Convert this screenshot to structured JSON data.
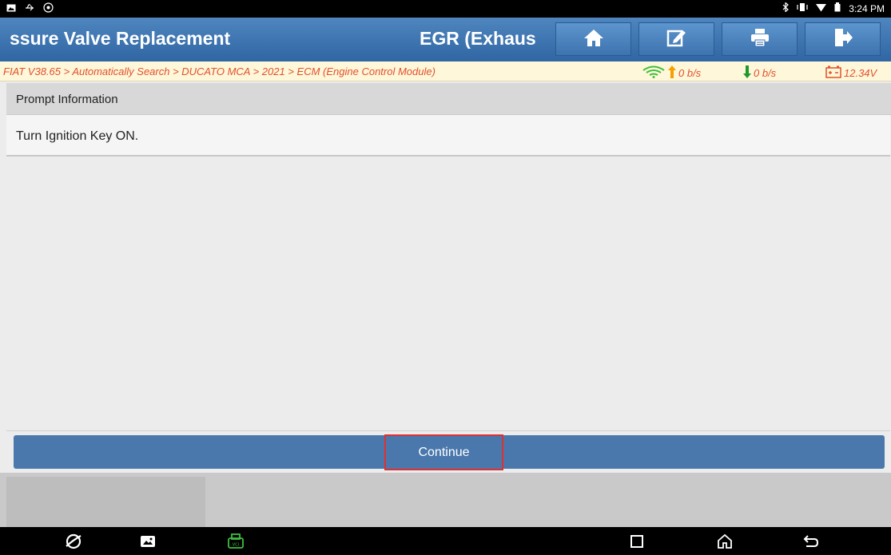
{
  "status_bar": {
    "time": "3:24 PM",
    "left_icons": [
      "gallery-icon",
      "usb-icon",
      "settings-icon"
    ],
    "right_icons": [
      "bluetooth-icon",
      "vibrate-icon",
      "wifi-icon",
      "battery-icon"
    ]
  },
  "header": {
    "title": "ssure Valve Replacement",
    "subtitle": "EGR (Exhaus",
    "buttons": [
      "home-icon",
      "edit-icon",
      "print-icon",
      "exit-icon"
    ]
  },
  "breadcrumb": {
    "path": "FIAT V38.65 > Automatically Search > DUCATO MCA > 2021 > ECM (Engine Control Module)",
    "upload": "0 b/s",
    "download": "0 b/s",
    "voltage": "12.34V"
  },
  "prompt": {
    "header": "Prompt Information",
    "message": "Turn Ignition Key ON."
  },
  "actions": {
    "continue_label": "Continue"
  },
  "colors": {
    "header_blue": "#3c72ad",
    "breadcrumb_text": "#e1502b",
    "continue_blue": "#4a78ad",
    "highlight_red": "#e03030",
    "vci_green": "#3fbf3f"
  },
  "nav_bar": {
    "icons": [
      "browser-icon",
      "gallery-icon",
      "vci-icon",
      "recents-icon",
      "home-icon",
      "back-icon"
    ]
  }
}
